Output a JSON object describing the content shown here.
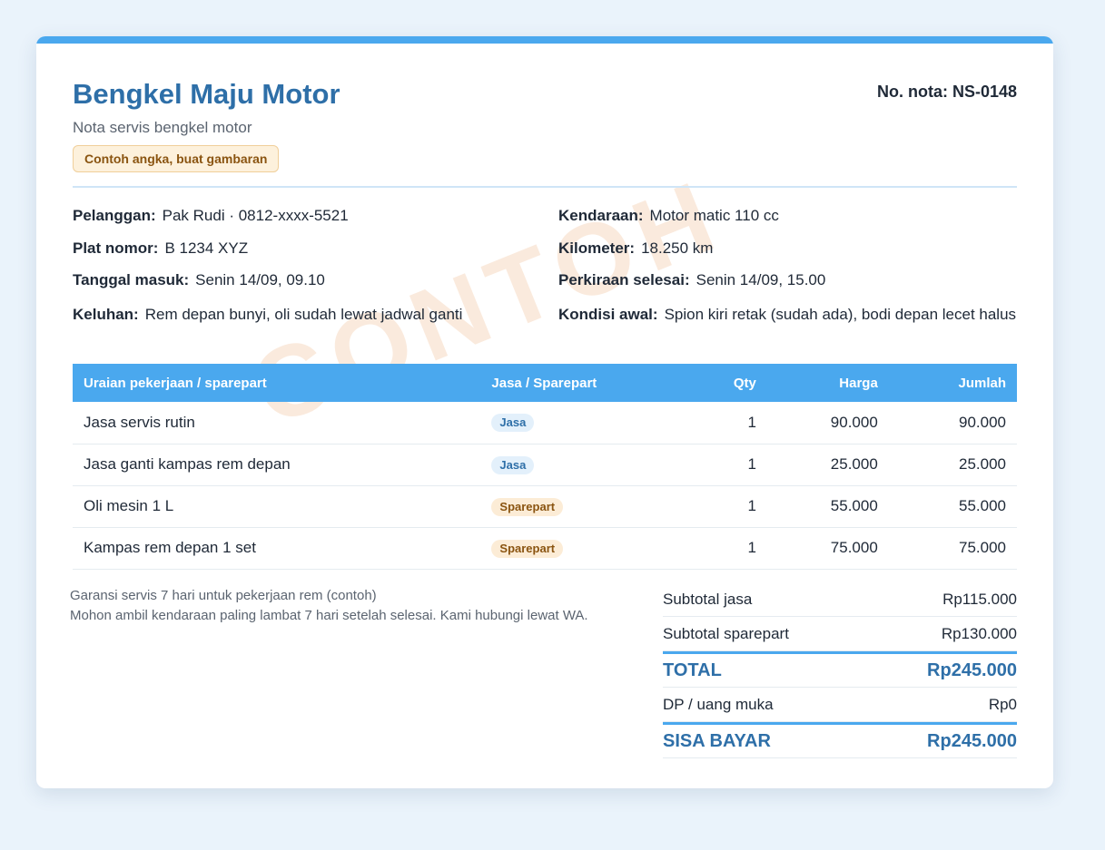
{
  "shop": {
    "name": "Bengkel Maju Motor",
    "subtitle": "Nota servis bengkel motor",
    "note_badge": "Contoh angka, buat gambaran",
    "invoice_no": "No. nota: NS-0148",
    "watermark": "CONTOH"
  },
  "colors": {
    "accent": "#4aa8ee",
    "brand": "#2e6fa8",
    "badge_bg": "#fdf1dc",
    "badge_text": "#8a5410"
  },
  "info_left": [
    {
      "label": "Pelanggan:",
      "value": "Pak Rudi · 0812-xxxx-5521"
    },
    {
      "label": "Plat nomor:",
      "value": "B 1234 XYZ"
    },
    {
      "label": "Tanggal masuk:",
      "value": "Senin 14/09, 09.10"
    },
    {
      "label": "Keluhan:",
      "value": "Rem depan bunyi, oli sudah lewat jadwal ganti"
    }
  ],
  "info_right": [
    {
      "label": "Kendaraan:",
      "value": "Motor matic 110 cc"
    },
    {
      "label": "Kilometer:",
      "value": "18.250 km"
    },
    {
      "label": "Perkiraan selesai:",
      "value": "Senin 14/09, 15.00"
    },
    {
      "label": "Kondisi awal:",
      "value": "Spion kiri retak (sudah ada), bodi depan lecet halus"
    }
  ],
  "table": {
    "headers": [
      "Uraian pekerjaan / sparepart",
      "Jasa / Sparepart",
      "Qty",
      "Harga",
      "Jumlah"
    ],
    "rows": [
      {
        "desc": "Jasa servis rutin",
        "type": "Jasa",
        "qty": "1",
        "price": "90.000",
        "amount": "90.000"
      },
      {
        "desc": "Jasa ganti kampas rem depan",
        "type": "Jasa",
        "qty": "1",
        "price": "25.000",
        "amount": "25.000"
      },
      {
        "desc": "Oli mesin 1 L",
        "type": "Sparepart",
        "qty": "1",
        "price": "55.000",
        "amount": "55.000"
      },
      {
        "desc": "Kampas rem depan 1 set",
        "type": "Sparepart",
        "qty": "1",
        "price": "75.000",
        "amount": "75.000"
      }
    ]
  },
  "notes": [
    "Garansi servis 7 hari untuk pekerjaan rem (contoh)",
    "Mohon ambil kendaraan paling lambat 7 hari setelah selesai. Kami hubungi lewat WA."
  ],
  "totals": {
    "subtotal_jasa_label": "Subtotal jasa",
    "subtotal_jasa": "Rp115.000",
    "subtotal_spare_label": "Subtotal sparepart",
    "subtotal_spare": "Rp130.000",
    "total_label": "TOTAL",
    "total": "Rp245.000",
    "dp_label": "DP / uang muka",
    "dp": "Rp0",
    "balance_label": "SISA BAYAR",
    "balance": "Rp245.000"
  }
}
